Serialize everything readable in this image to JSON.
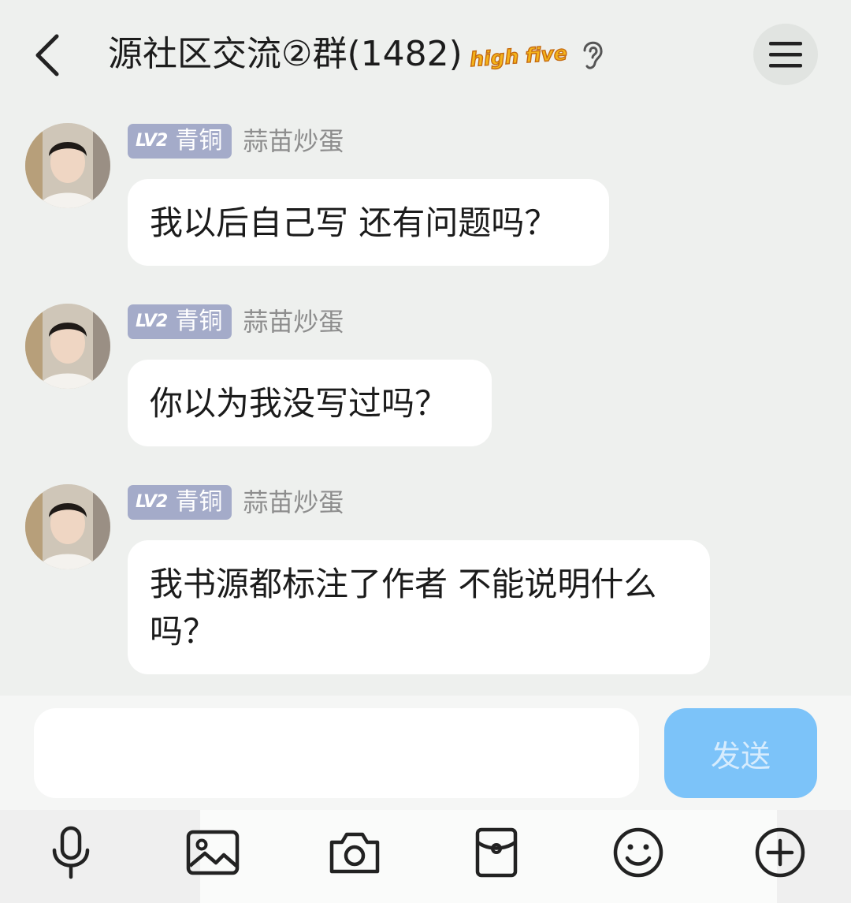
{
  "header": {
    "title": "源社区交流②群(1482)",
    "badge_text": "high five",
    "back_icon": "chevron-left-icon",
    "menu_icon": "hamburger-menu-icon",
    "ear_icon": "ear-icon"
  },
  "messages": [
    {
      "level_tag": "LV2",
      "level_name": "青铜",
      "sender": "蒜苗炒蛋",
      "text": "我以后自己写 还有问题吗？"
    },
    {
      "level_tag": "LV2",
      "level_name": "青铜",
      "sender": "蒜苗炒蛋",
      "text": "你以为我没写过吗？"
    },
    {
      "level_tag": "LV2",
      "level_name": "青铜",
      "sender": "蒜苗炒蛋",
      "text": "我书源都标注了作者 不能说明什么吗？"
    }
  ],
  "input": {
    "value": "",
    "placeholder": ""
  },
  "send_label": "发送",
  "toolbar_icons": [
    "microphone-icon",
    "image-icon",
    "camera-icon",
    "red-packet-icon",
    "emoji-icon",
    "plus-icon"
  ],
  "colors": {
    "background": "#eef0ee",
    "send_button": "#7cc3f9",
    "level_badge": "#a4abc9"
  }
}
